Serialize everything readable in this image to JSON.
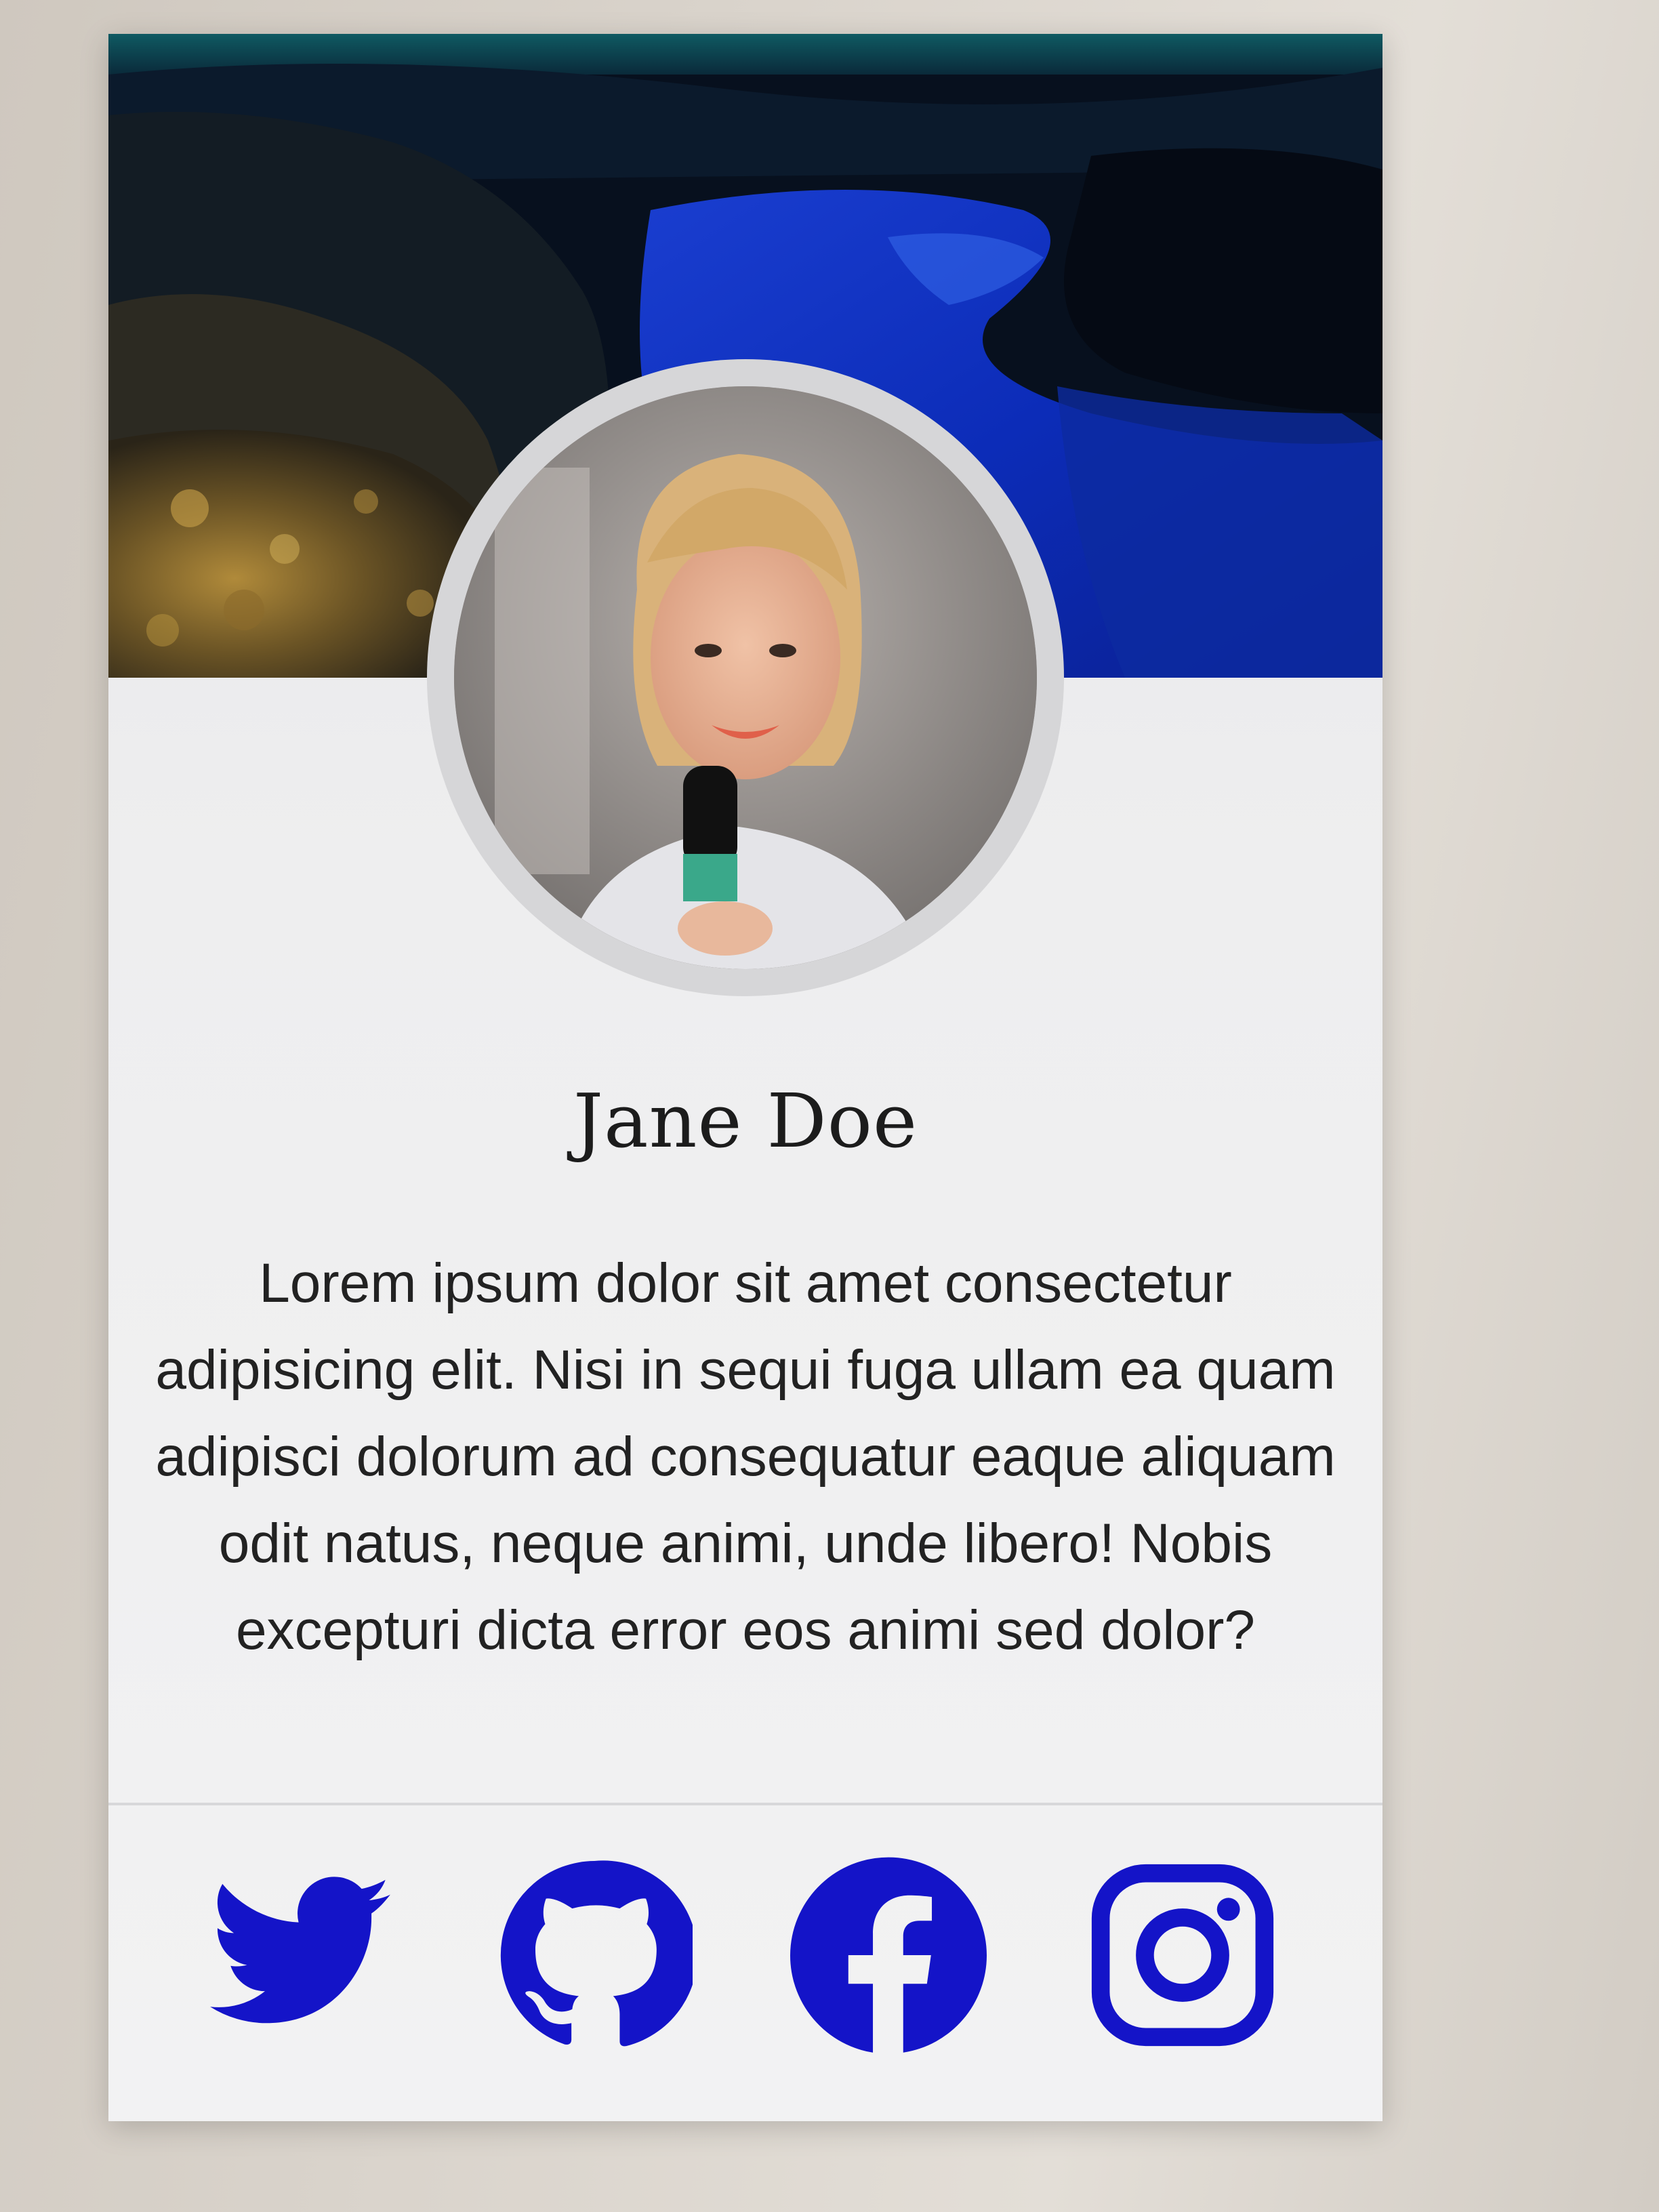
{
  "profile": {
    "name": "Jane Doe",
    "bio": "Lorem ipsum dolor sit amet consectetur adipisicing elit. Nisi in sequi fuga ullam ea quam adipisci dolorum ad consequatur eaque aliquam odit natus, neque animi, unde libero! Nobis excepturi dicta error eos animi sed dolor?"
  },
  "social": {
    "icons": [
      "twitter-icon",
      "github-icon",
      "facebook-icon",
      "instagram-icon"
    ],
    "color": "#1414c8"
  },
  "colors": {
    "card_bg": "#eeeeef",
    "accent": "#1414c8",
    "text": "#222222"
  }
}
